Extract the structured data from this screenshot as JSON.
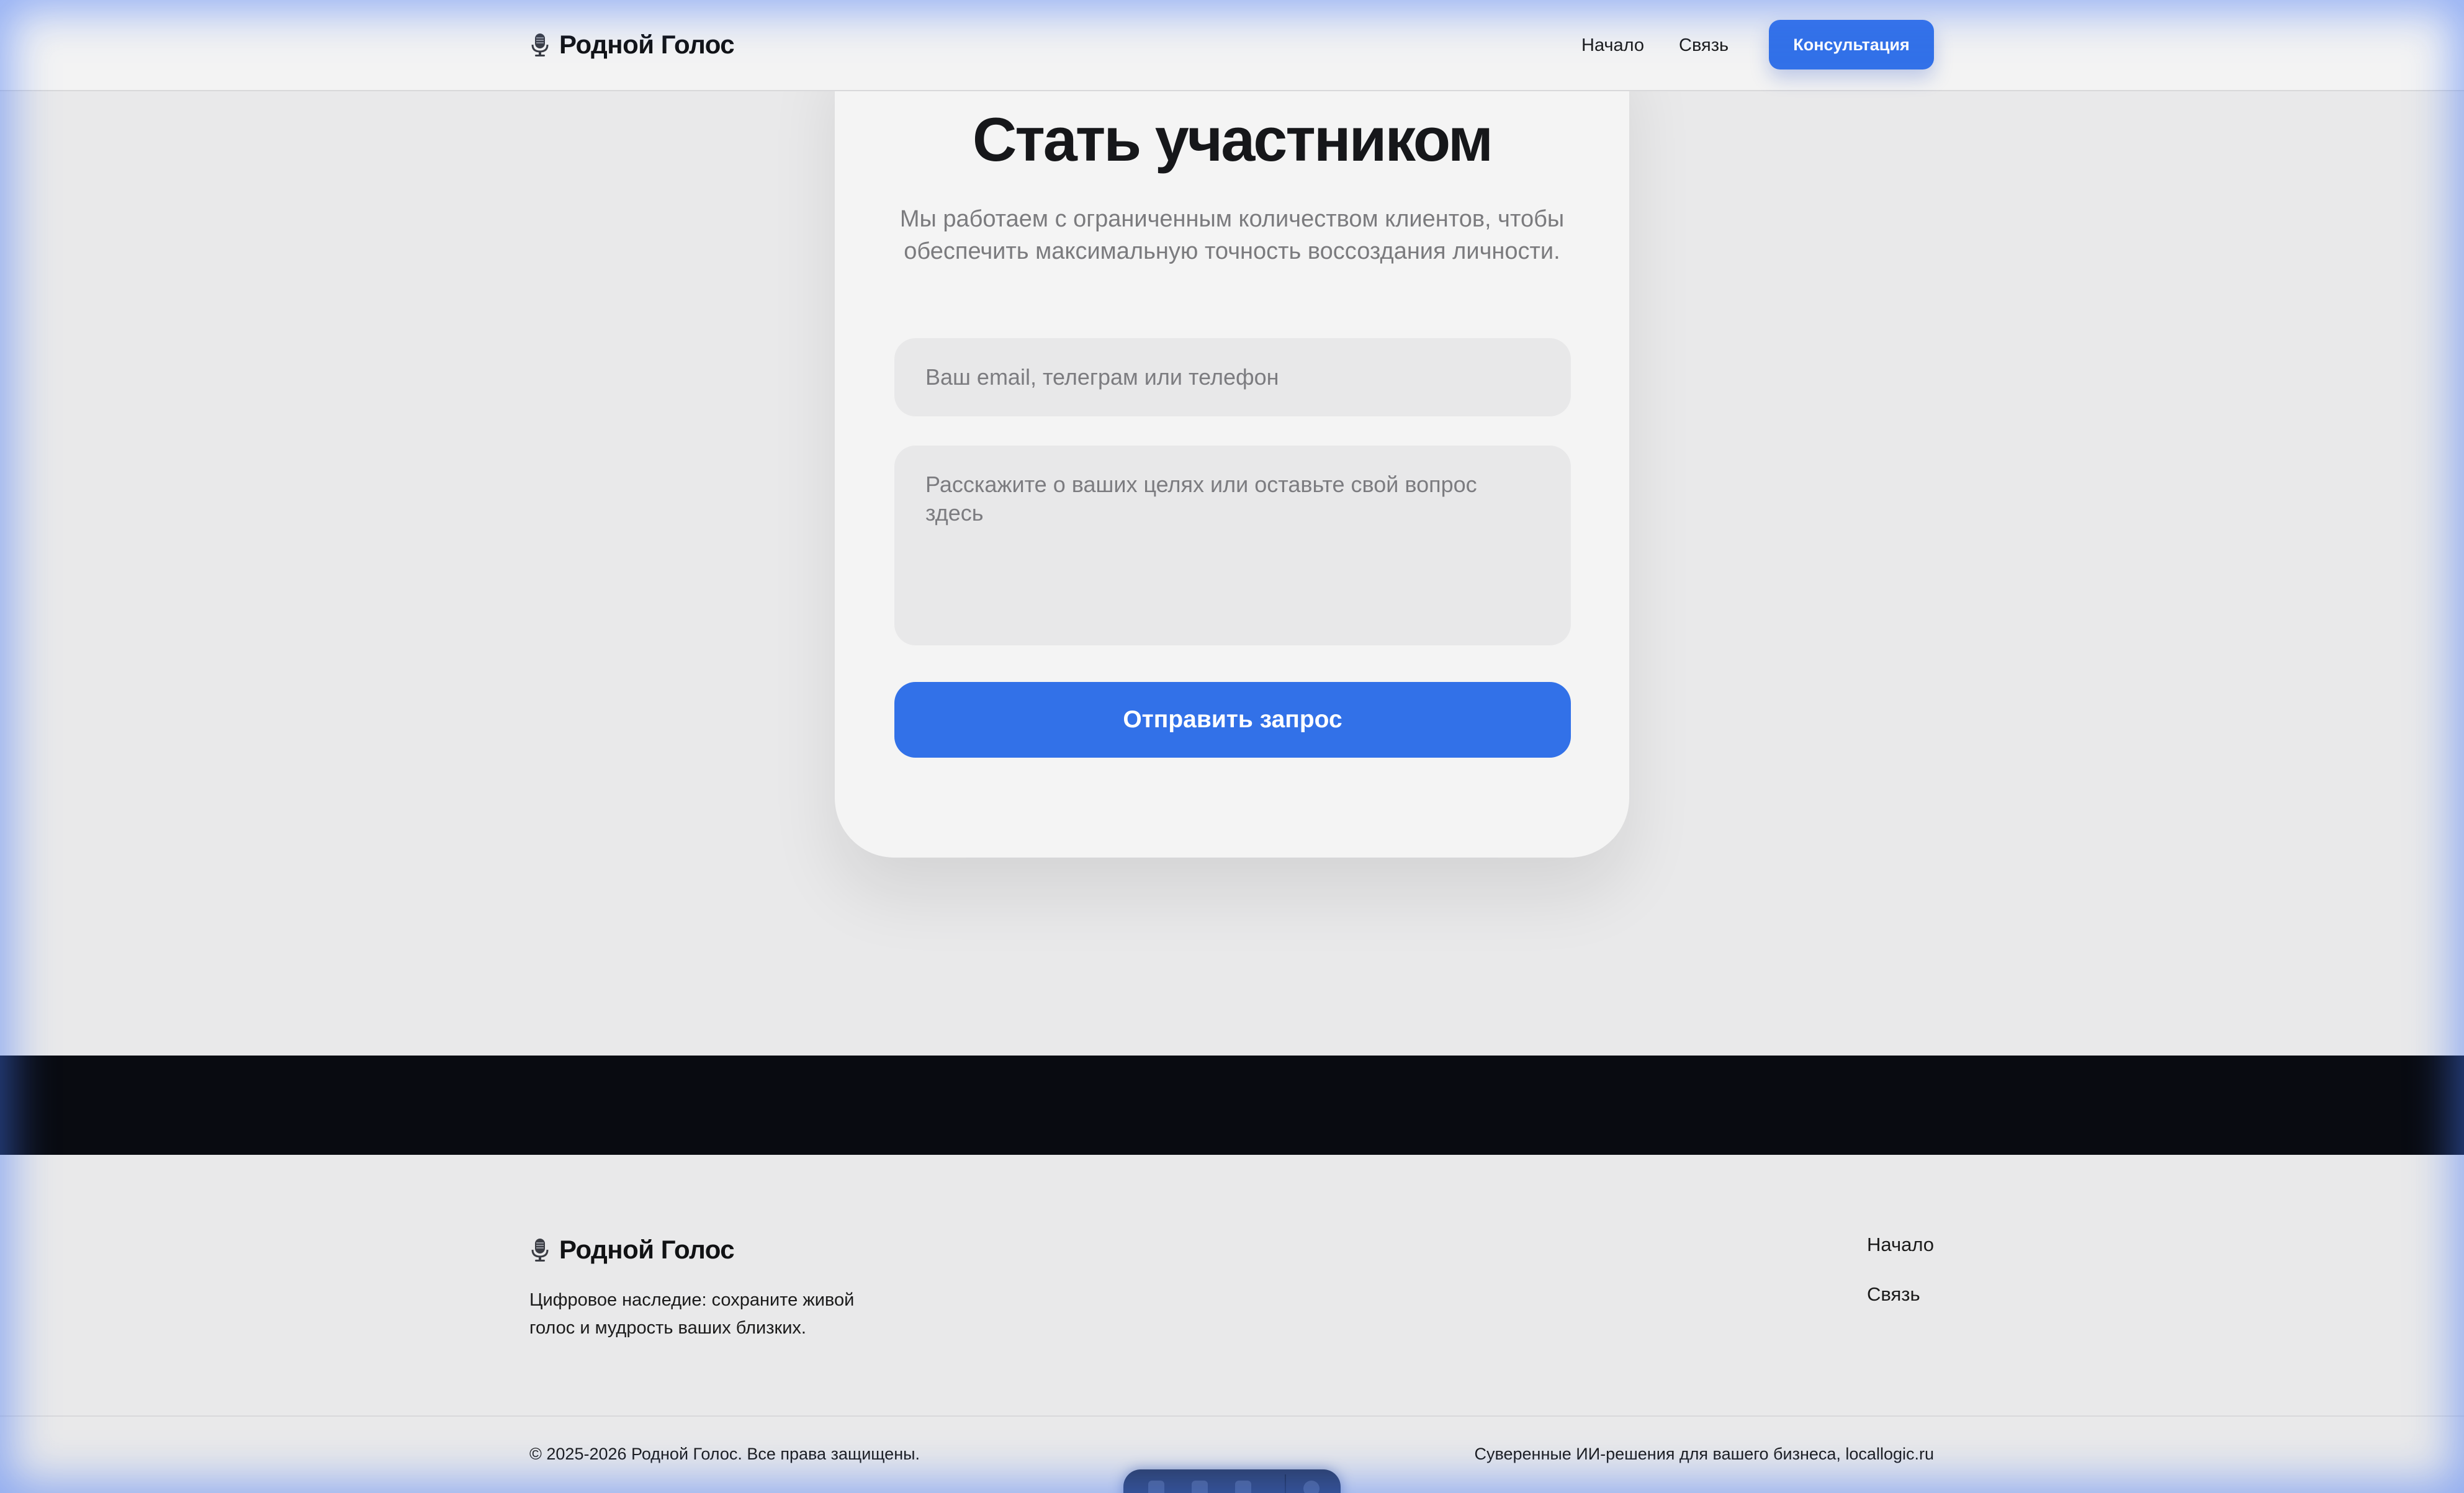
{
  "header": {
    "logo_text": "Родной Голос",
    "nav": [
      "Начало",
      "Связь"
    ],
    "cta_label": "Консультация"
  },
  "form": {
    "title": "Стать участником",
    "subtitle_line1": "Мы работаем с ограниченным количеством клиентов, чтобы",
    "subtitle_line2": "обеспечить максимальную точность воссоздания личности.",
    "contact_placeholder": "Ваш email, телеграм или телефон",
    "message_placeholder": "Расскажите о ваших целях или оставьте свой вопрос здесь",
    "submit_label": "Отправить запрос"
  },
  "footer": {
    "logo_text": "Родной Голос",
    "tagline_line1": "Цифровое наследие: сохраните живой",
    "tagline_line2": "голос и мудрость ваших близких.",
    "links": [
      "Начало",
      "Связь"
    ],
    "copyright": "© 2025-2026 Родной Голос. Все права защищены.",
    "credit": "Суверенные ИИ-решения для вашего бизнеса, locallogic.ru"
  },
  "icons": {
    "logo_icon": "microphone-icon"
  },
  "colors": {
    "accent": "#3271e8",
    "page_bg": "#e9e9ea",
    "card_bg": "#f4f4f4",
    "dark_band": "#090b11"
  }
}
